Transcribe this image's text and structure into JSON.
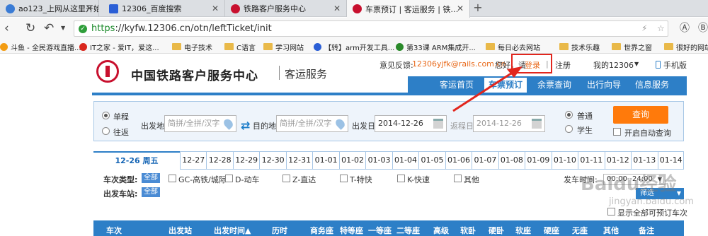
{
  "browser": {
    "tabs": [
      {
        "label": "ao123_上网从这里开始",
        "icon_color": "#3a7bd5"
      },
      {
        "label": "12306_百度搜索",
        "icon_color": "#2b5fd6"
      },
      {
        "label": "铁路客户服务中心",
        "icon_color": "#c8102e"
      },
      {
        "label": "车票预订 | 客运服务 | 铁…",
        "icon_color": "#c8102e"
      }
    ],
    "close_glyph": "✕",
    "new_tab_glyph": "+",
    "url_https": "https",
    "url_rest": "://kyfw.12306.cn/otn/leftTicket/init",
    "bookmarks": [
      {
        "label": "斗鱼 - 全民游戏直播...",
        "kind": "dot",
        "color": "#f39c12"
      },
      {
        "label": "IT之家 - 爱IT，爱这...",
        "kind": "dot",
        "color": "#d9261c"
      },
      {
        "label": "电子技术",
        "kind": "folder"
      },
      {
        "label": "C语言",
        "kind": "folder"
      },
      {
        "label": "学习网站",
        "kind": "folder"
      },
      {
        "label": "【转】arm开发工具...",
        "kind": "dot",
        "color": "#2b5fd6"
      },
      {
        "label": "第33课 ARM集成开...",
        "kind": "dot",
        "color": "#2a8a2a"
      },
      {
        "label": "每日必去网站",
        "kind": "folder"
      },
      {
        "label": "技术乐趣",
        "kind": "folder"
      },
      {
        "label": "世界之窗",
        "kind": "folder"
      },
      {
        "label": "很好的网站",
        "kind": "folder"
      }
    ]
  },
  "header": {
    "title": "中国铁路客户服务中心",
    "subtitle": "客运服务",
    "feedback_label": "意见反馈:",
    "feedback_email": "12306yjfk@rails.com.cn",
    "greeting": "您好，请",
    "login": "登录",
    "divider": "|",
    "register": "注册",
    "my_account": "我的12306",
    "mobile": "手机版"
  },
  "nav": {
    "items": [
      "客运首页",
      "车票预订",
      "余票查询",
      "出行向导",
      "信息服务"
    ],
    "active_index": 1
  },
  "search": {
    "trip_types": [
      "单程",
      "往返"
    ],
    "selected_trip": 0,
    "from_label": "出发地",
    "from_placeholder": "简拼/全拼/汉字",
    "to_label": "目的地",
    "to_placeholder": "简拼/全拼/汉字",
    "depart_label": "出发日",
    "depart_value": "2014-12-26",
    "return_label": "返程日",
    "return_value": "2014-12-26",
    "passenger_types": [
      "普通",
      "学生"
    ],
    "selected_passenger": 0,
    "query_button": "查询",
    "auto_query": "开启自动查询"
  },
  "dates": {
    "active": "12-26 周五",
    "items": [
      "12-27",
      "12-28",
      "12-29",
      "12-30",
      "12-31",
      "01-01",
      "01-02",
      "01-03",
      "01-04",
      "01-05",
      "01-06",
      "01-07",
      "01-08",
      "01-09",
      "01-10",
      "01-11",
      "01-12",
      "01-13",
      "01-14"
    ]
  },
  "filters": {
    "train_type_label": "车次类型:",
    "all_badge": "全部",
    "train_types": [
      "GC-高铁/城际",
      "D-动车",
      "Z-直达",
      "T-特快",
      "K-快速",
      "其他"
    ],
    "depart_time_label": "发车时间:",
    "depart_time_value": "00:00--24:00",
    "station_label": "出发车站:",
    "filter_button": "筛选",
    "show_all": "显示全部可预订车次"
  },
  "table": {
    "headers": [
      "车次",
      "出发站",
      "出发时间▲",
      "历时",
      "商务座",
      "特等座",
      "一等座",
      "二等座",
      "高级",
      "软卧",
      "硬卧",
      "软座",
      "硬座",
      "无座",
      "其他",
      "备注"
    ]
  },
  "watermark": {
    "brand": "Baidu经验",
    "sub": "jingyan.baidu.com"
  },
  "colors": {
    "brand_blue": "#2d7fc7",
    "brand_red": "#c8102e",
    "query_orange": "#ff7a0b",
    "annotation_red": "#e2261d"
  }
}
